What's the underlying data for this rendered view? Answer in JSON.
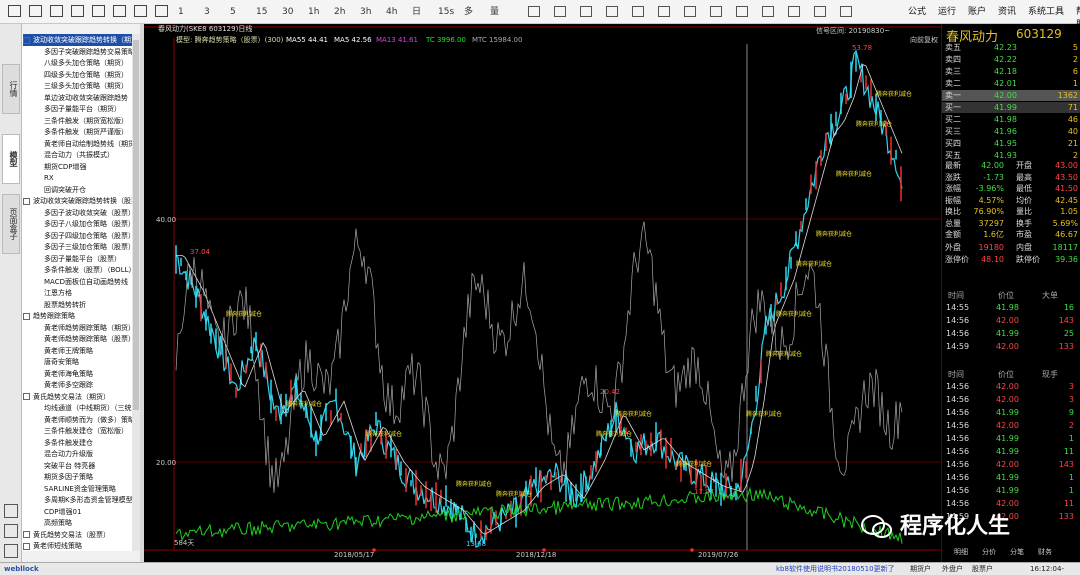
{
  "toolbar": {
    "icons": [
      "square-icon",
      "line-chart-icon",
      "bar-chart-icon",
      "grid-icon",
      "table-icon",
      "clock-icon",
      "refresh-icon",
      "window-icon"
    ],
    "periods": [
      "1",
      "3",
      "5",
      "15",
      "30",
      "1h",
      "2h",
      "3h",
      "4h",
      "日",
      "15s",
      "多",
      "量"
    ],
    "menus": [
      "公式",
      "运行",
      "账户",
      "资讯",
      "系统工具",
      "帮助"
    ]
  },
  "lefttabs": [
    {
      "label": "行情"
    },
    {
      "label": "模型"
    },
    {
      "label": "页面盒子"
    }
  ],
  "tree": [
    {
      "t": "波动收敛突破跟踪趋势转换（期货）",
      "lvl": 0,
      "sel": true
    },
    {
      "t": "多因子突破跟踪趋势交易策略",
      "lvl": 1
    },
    {
      "t": "八级多头加仓策略（期货）",
      "lvl": 1
    },
    {
      "t": "四级多头加仓策略（期货）",
      "lvl": 1
    },
    {
      "t": "三级多头加仓策略（期货）",
      "lvl": 1
    },
    {
      "t": "单边波动收敛突破跟踪趋势",
      "lvl": 1
    },
    {
      "t": "多因子量能平台（期货）",
      "lvl": 1
    },
    {
      "t": "三条件触发（期货宽松版）",
      "lvl": 1
    },
    {
      "t": "多条件触发（期货严谨版）",
      "lvl": 1
    },
    {
      "t": "黄老师自动绘制趋势线（期货）",
      "lvl": 1
    },
    {
      "t": "混合动力（共振模式）",
      "lvl": 1
    },
    {
      "t": "期货CDP增强",
      "lvl": 1
    },
    {
      "t": "RX",
      "lvl": 1
    },
    {
      "t": "回调突破开仓",
      "lvl": 1
    },
    {
      "t": "波动收敛突破跟踪趋势转换（股票）",
      "lvl": 0
    },
    {
      "t": "多因子波动收敛突破（股票）",
      "lvl": 1
    },
    {
      "t": "多因子八级加仓策略（股票）",
      "lvl": 1
    },
    {
      "t": "多因子四级加仓策略（股票）",
      "lvl": 1
    },
    {
      "t": "多因子三级加仓策略（股票）",
      "lvl": 1
    },
    {
      "t": "多因子量能平台（股票）",
      "lvl": 1
    },
    {
      "t": "多条件触发（股票）（BOLL）",
      "lvl": 1
    },
    {
      "t": "MACD面板位自动画趋势线",
      "lvl": 1
    },
    {
      "t": "江恩方格",
      "lvl": 1
    },
    {
      "t": "股票趋势转折",
      "lvl": 1
    },
    {
      "t": "趋势跟踪策略",
      "lvl": 0
    },
    {
      "t": "黄老师趋势跟踪策略（期货）",
      "lvl": 1
    },
    {
      "t": "黄老师趋势跟踪策略（股票）",
      "lvl": 1
    },
    {
      "t": "黄老师王牌策略",
      "lvl": 1
    },
    {
      "t": "唐奇安策略",
      "lvl": 1
    },
    {
      "t": "黄老师海龟策略",
      "lvl": 1
    },
    {
      "t": "黄老师多空跟踪",
      "lvl": 1
    },
    {
      "t": "黄氏趋势交易法（期货）",
      "lvl": 0
    },
    {
      "t": "均线通道（中线期货）（三统）",
      "lvl": 1
    },
    {
      "t": "黄老师顺势而为（做多）策略",
      "lvl": 1
    },
    {
      "t": "三条件触发建仓（宽松版）",
      "lvl": 1
    },
    {
      "t": "多条件触发建仓",
      "lvl": 1
    },
    {
      "t": "混合动力升级版",
      "lvl": 1
    },
    {
      "t": "突破平台 特亮器",
      "lvl": 1
    },
    {
      "t": "期货多因子策略",
      "lvl": 1
    },
    {
      "t": "SARLINE资金管理策略",
      "lvl": 1
    },
    {
      "t": "多周期K多形态资金管理模型",
      "lvl": 1
    },
    {
      "t": "CDP增强01",
      "lvl": 1
    },
    {
      "t": "高频策略",
      "lvl": 1
    },
    {
      "t": "黄氏趋势交易法（股票）",
      "lvl": 0
    },
    {
      "t": "黄老师短线策略",
      "lvl": 0
    }
  ],
  "chart": {
    "header_left": "春风动力(SKE8 603129)日线",
    "model": "模型: 腾奔趋势策略（股票）(300)",
    "ma5": "MA55 44.41",
    "ma": "MA5 42.56",
    "ma13": "MA13 41.61",
    "tc": "TC 3996.00",
    "mtc": "MTC 15984.00",
    "signal_label": "信号区间: 20190830~",
    "restore_label": "向前复权",
    "y_labels": [
      "40.00",
      "20.00"
    ],
    "price_labels": [
      "53.78",
      "37.04",
      "20.42",
      "17.97",
      "13.68"
    ],
    "bars_label": "584天",
    "dates": [
      "2018/05/17",
      "2018/12/18",
      "2019/07/26"
    ],
    "signal_text": "腾奔获利减仓"
  },
  "chart_data": {
    "type": "line",
    "series": [
      {
        "name": "春风动力",
        "x": [
          "2018/05/17",
          "2018/12/18",
          "2019/07/26"
        ],
        "values": [
          37.04,
          13.68,
          17.97
        ]
      }
    ],
    "ylim": [
      10,
      56
    ],
    "title": "春风动力(SKE8 603129)日线"
  },
  "quote": {
    "name": "春风动力",
    "code": "603129",
    "asks": [
      {
        "l": "卖五",
        "p": "42.23",
        "v": "5"
      },
      {
        "l": "卖四",
        "p": "42.22",
        "v": "2"
      },
      {
        "l": "卖三",
        "p": "42.18",
        "v": "6"
      },
      {
        "l": "卖二",
        "p": "42.01",
        "v": "1"
      },
      {
        "l": "卖一",
        "p": "42.00",
        "v": "1362"
      }
    ],
    "bids": [
      {
        "l": "买一",
        "p": "41.99",
        "v": "71"
      },
      {
        "l": "买二",
        "p": "41.98",
        "v": "46"
      },
      {
        "l": "买三",
        "p": "41.96",
        "v": "40"
      },
      {
        "l": "买四",
        "p": "41.95",
        "v": "21"
      },
      {
        "l": "买五",
        "p": "41.93",
        "v": "2"
      }
    ],
    "stats": [
      [
        "最新",
        "42.00",
        "开盘",
        "43.00"
      ],
      [
        "涨跌",
        "-1.73",
        "最高",
        "43.50"
      ],
      [
        "涨幅",
        "-3.96%",
        "最低",
        "41.50"
      ],
      [
        "振幅",
        "4.57%",
        "均价",
        "42.45"
      ],
      [
        "换比",
        "76.90%",
        "量比",
        "1.05"
      ],
      [
        "总量",
        "37297",
        "换手",
        "5.69%"
      ],
      [
        "金额",
        "1.6亿",
        "市盈",
        "46.67"
      ]
    ],
    "outer": [
      "外盘",
      "19180",
      "内盘",
      "18117"
    ],
    "limit": [
      "涨停价",
      "48.10",
      "跌停价",
      "39.36"
    ],
    "tick_headers": [
      "时间",
      "价位",
      "大单"
    ],
    "ticks1": [
      [
        "14:55",
        "41.98",
        "16"
      ],
      [
        "14:56",
        "42.00",
        "143"
      ],
      [
        "14:56",
        "41.99",
        "25"
      ],
      [
        "14:59",
        "42.00",
        "133"
      ]
    ],
    "tick_headers2": [
      "时间",
      "价位",
      "现手"
    ],
    "ticks2": [
      [
        "14:56",
        "42.00",
        "3"
      ],
      [
        "14:56",
        "42.00",
        "3"
      ],
      [
        "14:56",
        "41.99",
        "9"
      ],
      [
        "14:56",
        "42.00",
        "2"
      ],
      [
        "14:56",
        "41.99",
        "1"
      ],
      [
        "14:56",
        "41.99",
        "11"
      ],
      [
        "14:56",
        "42.00",
        "143"
      ],
      [
        "14:56",
        "41.99",
        "1"
      ],
      [
        "14:56",
        "41.99",
        "1"
      ],
      [
        "14:56",
        "42.00",
        "11"
      ],
      [
        "14:59",
        "42.00",
        "133"
      ]
    ],
    "bottom_tabs": [
      "明细",
      "分价",
      "分笔",
      "财务"
    ]
  },
  "watermark": "程序化人生",
  "status": {
    "logo": "webllock",
    "notice": "kb8软件使用说明书20180510更新了",
    "btns": [
      "期货户",
      "外盘户",
      "股票户"
    ],
    "time": "16:12:04-Local"
  }
}
